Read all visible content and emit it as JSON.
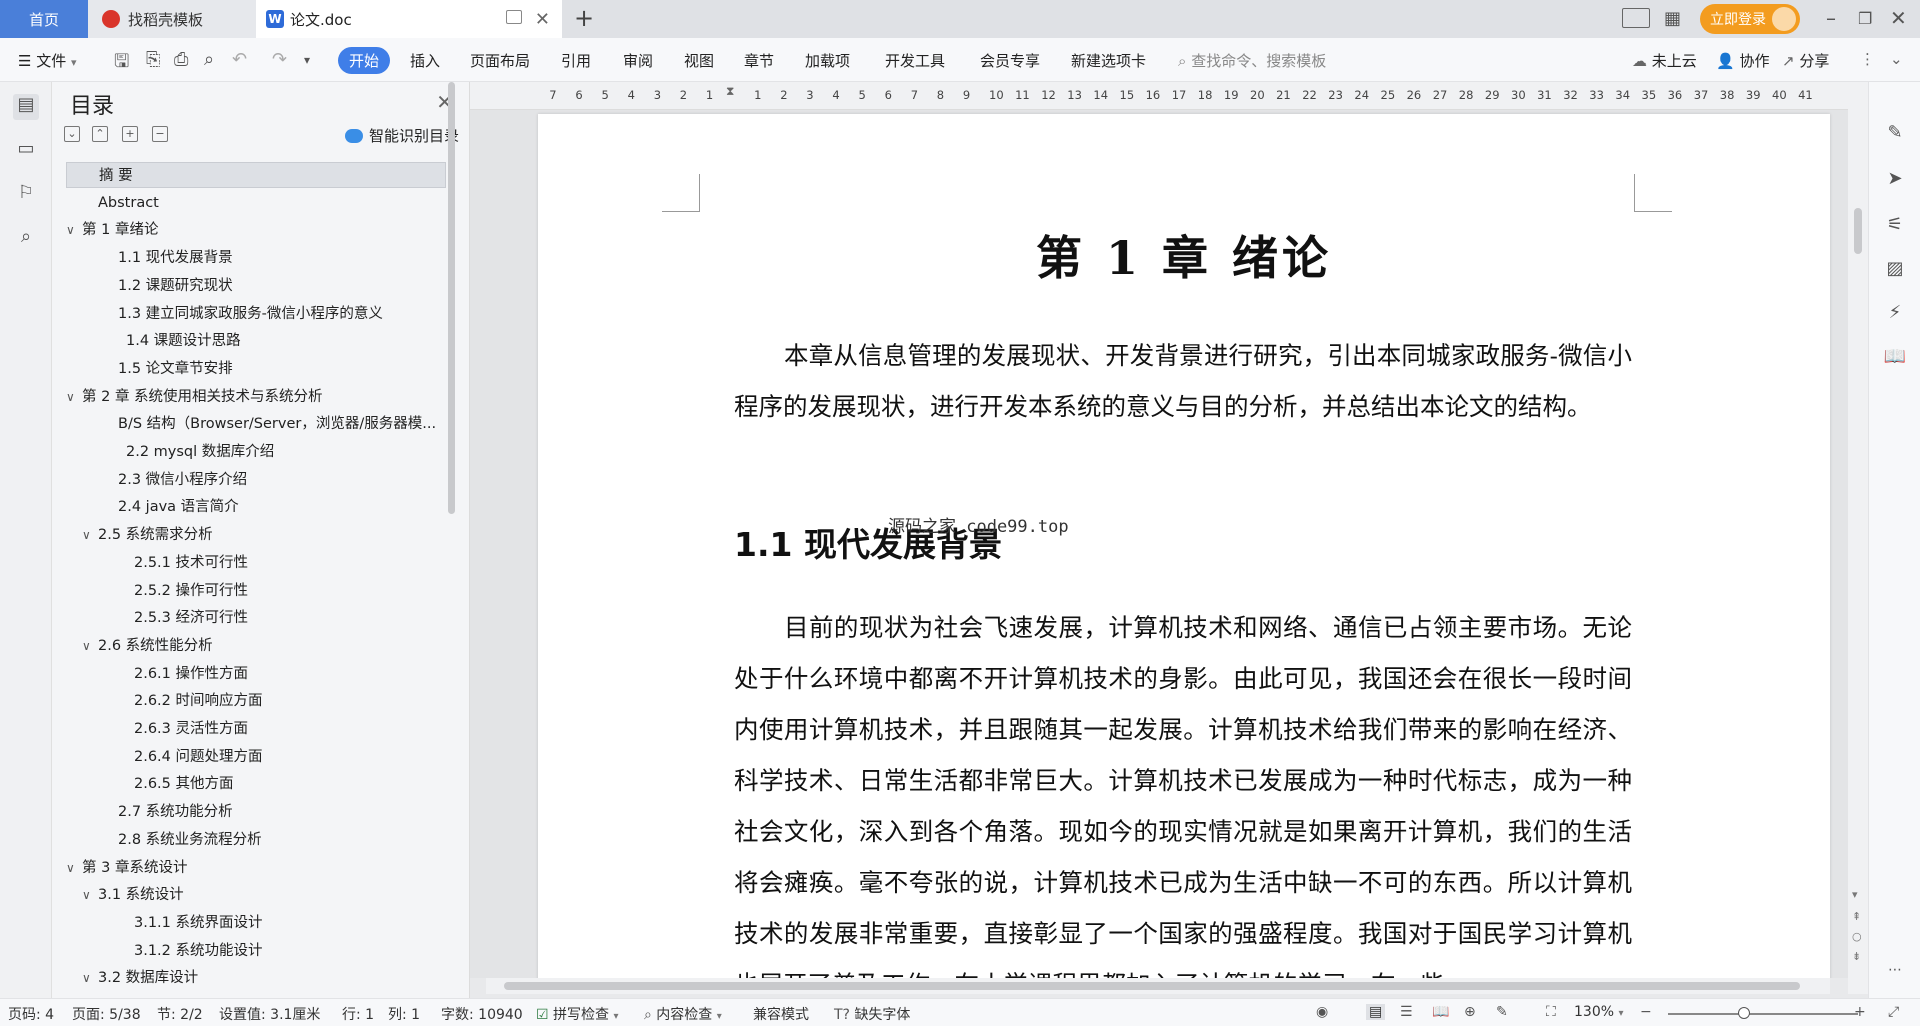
{
  "tabs": {
    "home": "首页",
    "template": "找稻壳模板",
    "doc": "论文.doc"
  },
  "titlebar": {
    "login": "立即登录"
  },
  "ribbon": {
    "file": "文件",
    "items": [
      "开始",
      "插入",
      "页面布局",
      "引用",
      "审阅",
      "视图",
      "章节",
      "加载项",
      "开发工具",
      "会员专享",
      "新建选项卡"
    ],
    "search_placeholder": "查找命令、搜索模板",
    "cloud": "未上云",
    "collab": "协作",
    "share": "分享"
  },
  "toc": {
    "title": "目录",
    "smart": "智能识别目录",
    "items": [
      {
        "label": "摘  要",
        "indent": 1,
        "caret": "",
        "selected": true
      },
      {
        "label": "Abstract",
        "indent": 1,
        "caret": ""
      },
      {
        "label": "第 1 章绪论",
        "indent": 0,
        "caret": "open"
      },
      {
        "label": "1.1  现代发展背景",
        "indent": 2,
        "caret": ""
      },
      {
        "label": "1.2  课题研究现状",
        "indent": 2,
        "caret": ""
      },
      {
        "label": "1.3  建立同城家政服务-微信小程序的意义",
        "indent": 2,
        "caret": ""
      },
      {
        "label": "1.4  课题设计思路",
        "indent": 3,
        "caret": ""
      },
      {
        "label": "1.5  论文章节安排",
        "indent": 2,
        "caret": ""
      },
      {
        "label": "第 2 章  系统使用相关技术与系统分析",
        "indent": 0,
        "caret": "open"
      },
      {
        "label": "B/S 结构（Browser/Server，浏览器/服务器模...",
        "indent": 2,
        "caret": ""
      },
      {
        "label": "2.2 mysql 数据库介绍",
        "indent": 3,
        "caret": ""
      },
      {
        "label": "2.3  微信小程序介绍",
        "indent": 2,
        "caret": ""
      },
      {
        "label": "2.4 java 语言简介",
        "indent": 2,
        "caret": ""
      },
      {
        "label": "2.5 系统需求分析",
        "indent": 1,
        "caret": "open"
      },
      {
        "label": "2.5.1  技术可行性",
        "indent": 4,
        "caret": ""
      },
      {
        "label": "2.5.2  操作可行性",
        "indent": 4,
        "caret": ""
      },
      {
        "label": "2.5.3 经济可行性",
        "indent": 4,
        "caret": ""
      },
      {
        "label": "2.6  系统性能分析",
        "indent": 1,
        "caret": "open"
      },
      {
        "label": "2.6.1 操作性方面",
        "indent": 4,
        "caret": ""
      },
      {
        "label": "2.6.2  时间响应方面",
        "indent": 4,
        "caret": ""
      },
      {
        "label": "2.6.3 灵活性方面",
        "indent": 4,
        "caret": ""
      },
      {
        "label": "2.6.4 问题处理方面",
        "indent": 4,
        "caret": ""
      },
      {
        "label": "2.6.5 其他方面",
        "indent": 4,
        "caret": ""
      },
      {
        "label": "2.7 系统功能分析",
        "indent": 2,
        "caret": ""
      },
      {
        "label": "2.8 系统业务流程分析",
        "indent": 2,
        "caret": ""
      },
      {
        "label": "第 3 章系统设计",
        "indent": 0,
        "caret": "open"
      },
      {
        "label": "3.1  系统设计",
        "indent": 1,
        "caret": "open"
      },
      {
        "label": "3.1.1 系统界面设计",
        "indent": 4,
        "caret": ""
      },
      {
        "label": "3.1.2 系统功能设计",
        "indent": 4,
        "caret": ""
      },
      {
        "label": "3.2  数据库设计",
        "indent": 1,
        "caret": "open"
      }
    ]
  },
  "ruler": {
    "left": [
      "7",
      "6",
      "5",
      "4",
      "3",
      "2",
      "1"
    ],
    "right": [
      "1",
      "2",
      "3",
      "4",
      "5",
      "6",
      "7",
      "8",
      "9",
      "10",
      "11",
      "12",
      "13",
      "14",
      "15",
      "16",
      "17",
      "18",
      "19",
      "20",
      "21",
      "22",
      "23",
      "24",
      "25",
      "26",
      "27",
      "28",
      "29",
      "30",
      "31",
      "32",
      "33",
      "34",
      "35",
      "36",
      "37",
      "38",
      "39",
      "40",
      "41"
    ]
  },
  "document": {
    "chapter_title": "第 1 章  绪论",
    "intro": "本章从信息管理的发展现状、开发背景进行研究，引出本同城家政服务-微信小程序的发展现状，进行开发本系统的意义与目的分析，并总结出本论文的结构。",
    "heading_1_1": "1.1  现代发展背景",
    "watermark": "源码之家 code99.top",
    "para2": "目前的现状为社会飞速发展，计算机技术和网络、通信已占领主要市场。无论处于什么环境中都离不开计算机技术的身影。由此可见，我国还会在很长一段时间内使用计算机技术，并且跟随其一起发展。计算机技术给我们带来的影响在经济、科学技术、日常生活都非常巨大。计算机技术已发展成为一种时代标志，成为一种社会文化，深入到各个角落。现如今的现实情况就是如果离开计算机，我们的生活将会瘫痪。毫不夸张的说，计算机技术已成为生活中缺一不可的东西。所以计算机技术的发展非常重要，直接彰显了一个国家的强盛程度。我国对于国民学习计算机也展开了普及工作，在小学课程里都加入了计算机的学习，在一些"
  },
  "status": {
    "page_code": "页码: 4",
    "page": "页面: 5/38",
    "section": "节: 2/2",
    "setting": "设置值: 3.1厘米",
    "row": "行: 1",
    "col": "列: 1",
    "words": "字数: 10940",
    "spell": "拼写检查",
    "content_check": "内容检查",
    "compat": "兼容模式",
    "missing_font": "缺失字体",
    "zoom": "130%",
    "zoom_level_fraction": 0.4
  }
}
